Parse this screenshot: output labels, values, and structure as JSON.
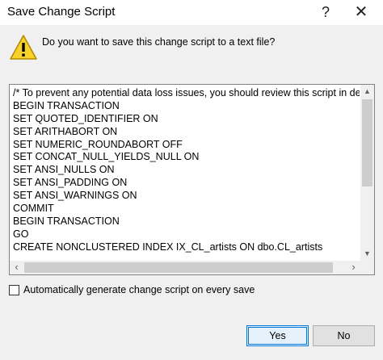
{
  "window": {
    "title": "Save Change Script",
    "help_label": "?",
    "close_label": "✕"
  },
  "dialog": {
    "question": "Do you want to save this change script to a text file?",
    "icon": "warning-icon",
    "script_lines": [
      "/* To prevent any potential data loss issues, you should review this script in detail befor",
      "BEGIN TRANSACTION",
      "SET QUOTED_IDENTIFIER ON",
      "SET ARITHABORT ON",
      "SET NUMERIC_ROUNDABORT OFF",
      "SET CONCAT_NULL_YIELDS_NULL ON",
      "SET ANSI_NULLS ON",
      "SET ANSI_PADDING ON",
      "SET ANSI_WARNINGS ON",
      "COMMIT",
      "BEGIN TRANSACTION",
      "GO",
      "CREATE NONCLUSTERED INDEX IX_CL_artists ON dbo.CL_artists"
    ],
    "auto_generate_label": "Automatically generate change script on every save",
    "auto_generate_checked": false
  },
  "buttons": {
    "yes_label": "Yes",
    "no_label": "No"
  },
  "colors": {
    "accent": "#0078d7",
    "warning_fill": "#f8d22a"
  }
}
